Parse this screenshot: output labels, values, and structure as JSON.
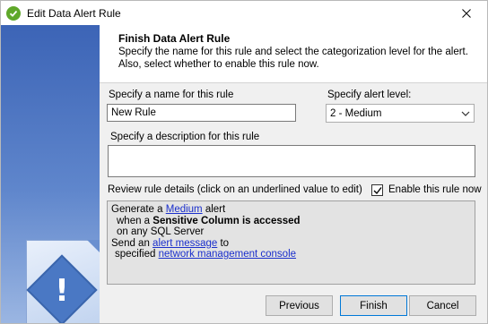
{
  "window": {
    "title": "Edit Data Alert Rule"
  },
  "header": {
    "title": "Finish Data Alert Rule",
    "description": "Specify the name for this rule and select the categorization level for the alert. Also, select whether to enable this rule now."
  },
  "form": {
    "name_label": "Specify a name for this rule",
    "name_value": "New Rule",
    "level_label": "Specify alert level:",
    "level_value": "2 - Medium",
    "description_label": "Specify a description for this rule",
    "description_value": "",
    "review_label": "Review rule details (click on an underlined value to edit)",
    "enable_label": "Enable this rule now",
    "enable_checked": true
  },
  "rule_details": {
    "line1_prefix": "Generate a ",
    "line1_link": "Medium",
    "line1_suffix": " alert",
    "line2_prefix": "when a ",
    "line2_bold": "Sensitive Column is accessed",
    "line3": "on any SQL Server",
    "line4_prefix": "Send an ",
    "line4_link": "alert message",
    "line4_suffix": " to",
    "line5_prefix": "specified ",
    "line5_link": "network management console"
  },
  "buttons": {
    "previous": "Previous",
    "finish": "Finish",
    "cancel": "Cancel"
  },
  "colors": {
    "title_icon": "#5fa82a",
    "side_panel": "#3c64b6",
    "link": "#1a2fcc",
    "primary_border": "#0078d7"
  }
}
